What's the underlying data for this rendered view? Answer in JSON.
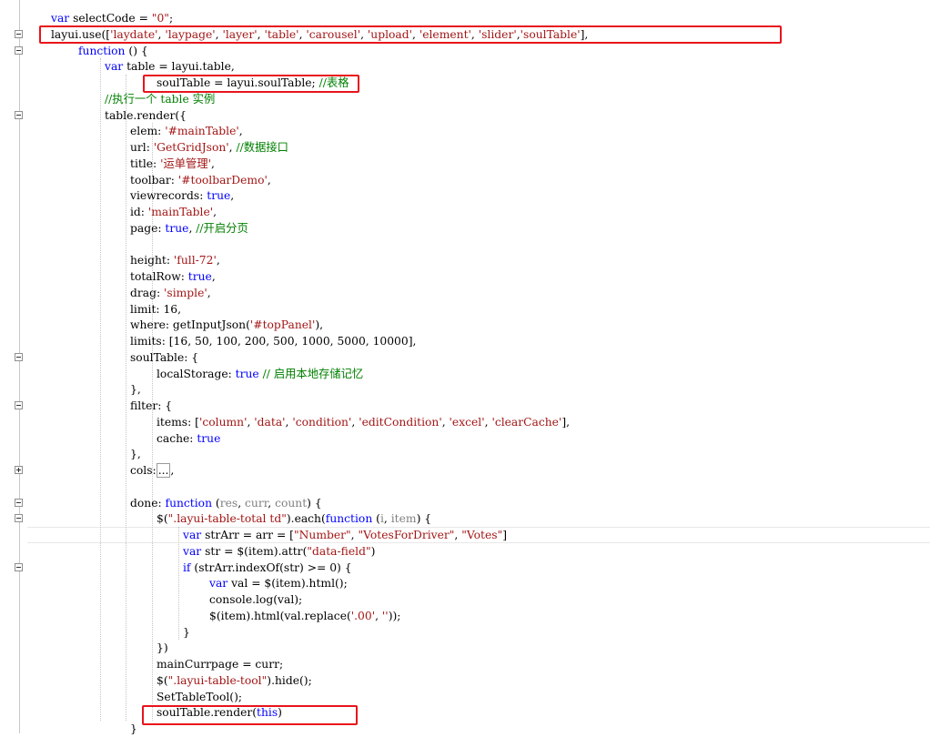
{
  "editor": {
    "lines": [
      {
        "id": 0,
        "tokens": [
          {
            "t": "var",
            "c": "kw"
          },
          {
            "t": " selectCode = "
          },
          {
            "t": "\"0\"",
            "c": "str"
          },
          {
            "t": ";"
          }
        ]
      },
      {
        "id": 1,
        "tokens": [
          {
            "t": "layui.use(["
          },
          {
            "t": "'laydate'",
            "c": "str"
          },
          {
            "t": ", "
          },
          {
            "t": "'laypage'",
            "c": "str"
          },
          {
            "t": ", "
          },
          {
            "t": "'layer'",
            "c": "str"
          },
          {
            "t": ", "
          },
          {
            "t": "'table'",
            "c": "str"
          },
          {
            "t": ", "
          },
          {
            "t": "'carousel'",
            "c": "str"
          },
          {
            "t": ", "
          },
          {
            "t": "'upload'",
            "c": "str"
          },
          {
            "t": ", "
          },
          {
            "t": "'element'",
            "c": "str"
          },
          {
            "t": ", "
          },
          {
            "t": "'slider'",
            "c": "str"
          },
          {
            "t": ","
          },
          {
            "t": "'soulTable'",
            "c": "str"
          },
          {
            "t": "],"
          }
        ]
      },
      {
        "id": 2,
        "tokens": [
          {
            "t": "function",
            "c": "kw"
          },
          {
            "t": " () {"
          }
        ]
      },
      {
        "id": 3,
        "tokens": [
          {
            "t": "var",
            "c": "kw"
          },
          {
            "t": " table = layui.table,"
          }
        ]
      },
      {
        "id": 4,
        "tokens": [
          {
            "t": "soulTable = layui.soulTable; "
          },
          {
            "t": "//表格",
            "c": "cmt"
          }
        ]
      },
      {
        "id": 5,
        "tokens": [
          {
            "t": "//执行一个 table 实例",
            "c": "cmt"
          }
        ]
      },
      {
        "id": 6,
        "tokens": [
          {
            "t": "table.render({"
          }
        ]
      },
      {
        "id": 7,
        "tokens": [
          {
            "t": "elem: "
          },
          {
            "t": "'#mainTable'",
            "c": "str"
          },
          {
            "t": ","
          }
        ]
      },
      {
        "id": 8,
        "tokens": [
          {
            "t": "url: "
          },
          {
            "t": "'GetGridJson'",
            "c": "str"
          },
          {
            "t": ", "
          },
          {
            "t": "//数据接口",
            "c": "cmt"
          }
        ]
      },
      {
        "id": 9,
        "tokens": [
          {
            "t": "title: "
          },
          {
            "t": "'运单管理'",
            "c": "str"
          },
          {
            "t": ","
          }
        ]
      },
      {
        "id": 10,
        "tokens": [
          {
            "t": "toolbar: "
          },
          {
            "t": "'#toolbarDemo'",
            "c": "str"
          },
          {
            "t": ","
          }
        ]
      },
      {
        "id": 11,
        "tokens": [
          {
            "t": "viewrecords: "
          },
          {
            "t": "true",
            "c": "kw"
          },
          {
            "t": ","
          }
        ]
      },
      {
        "id": 12,
        "tokens": [
          {
            "t": "id: "
          },
          {
            "t": "'mainTable'",
            "c": "str"
          },
          {
            "t": ","
          }
        ]
      },
      {
        "id": 13,
        "tokens": [
          {
            "t": "page: "
          },
          {
            "t": "true",
            "c": "kw"
          },
          {
            "t": ", "
          },
          {
            "t": "//开启分页",
            "c": "cmt"
          }
        ]
      },
      {
        "id": 14,
        "tokens": []
      },
      {
        "id": 15,
        "tokens": [
          {
            "t": "height: "
          },
          {
            "t": "'full-72'",
            "c": "str"
          },
          {
            "t": ","
          }
        ]
      },
      {
        "id": 16,
        "tokens": [
          {
            "t": "totalRow: "
          },
          {
            "t": "true",
            "c": "kw"
          },
          {
            "t": ","
          }
        ]
      },
      {
        "id": 17,
        "tokens": [
          {
            "t": "drag: "
          },
          {
            "t": "'simple'",
            "c": "str"
          },
          {
            "t": ","
          }
        ]
      },
      {
        "id": 18,
        "tokens": [
          {
            "t": "limit: 16,"
          }
        ]
      },
      {
        "id": 19,
        "tokens": [
          {
            "t": "where: getInputJson("
          },
          {
            "t": "'#topPanel'",
            "c": "str"
          },
          {
            "t": "),"
          }
        ]
      },
      {
        "id": 20,
        "tokens": [
          {
            "t": "limits: [16, 50, 100, 200, 500, 1000, 5000, 10000],"
          }
        ]
      },
      {
        "id": 21,
        "tokens": [
          {
            "t": "soulTable: {"
          }
        ]
      },
      {
        "id": 22,
        "tokens": [
          {
            "t": "localStorage: "
          },
          {
            "t": "true",
            "c": "kw"
          },
          {
            "t": " "
          },
          {
            "t": "// 启用本地存储记忆",
            "c": "cmt"
          }
        ]
      },
      {
        "id": 23,
        "tokens": [
          {
            "t": "},"
          }
        ]
      },
      {
        "id": 24,
        "tokens": [
          {
            "t": "filter: {"
          }
        ]
      },
      {
        "id": 25,
        "tokens": [
          {
            "t": "items: ["
          },
          {
            "t": "'column'",
            "c": "str"
          },
          {
            "t": ", "
          },
          {
            "t": "'data'",
            "c": "str"
          },
          {
            "t": ", "
          },
          {
            "t": "'condition'",
            "c": "str"
          },
          {
            "t": ", "
          },
          {
            "t": "'editCondition'",
            "c": "str"
          },
          {
            "t": ", "
          },
          {
            "t": "'excel'",
            "c": "str"
          },
          {
            "t": ", "
          },
          {
            "t": "'clearCache'",
            "c": "str"
          },
          {
            "t": "],"
          }
        ]
      },
      {
        "id": 26,
        "tokens": [
          {
            "t": "cache: "
          },
          {
            "t": "true",
            "c": "kw"
          }
        ]
      },
      {
        "id": 27,
        "tokens": [
          {
            "t": "},"
          }
        ]
      },
      {
        "id": 28,
        "tokens": [
          {
            "t": "cols:"
          },
          {
            "t": "...",
            "c": "collapsed"
          },
          {
            "t": ","
          }
        ]
      },
      {
        "id": 29,
        "tokens": []
      },
      {
        "id": 30,
        "tokens": [
          {
            "t": "done: "
          },
          {
            "t": "function",
            "c": "kw"
          },
          {
            "t": " ("
          },
          {
            "t": "res",
            "c": "prm"
          },
          {
            "t": ", "
          },
          {
            "t": "curr",
            "c": "prm"
          },
          {
            "t": ", "
          },
          {
            "t": "count",
            "c": "prm"
          },
          {
            "t": ") {"
          }
        ]
      },
      {
        "id": 31,
        "tokens": [
          {
            "t": "$("
          },
          {
            "t": "\".layui-table-total td\"",
            "c": "str"
          },
          {
            "t": ").each("
          },
          {
            "t": "function",
            "c": "kw"
          },
          {
            "t": " ("
          },
          {
            "t": "i",
            "c": "prm"
          },
          {
            "t": ", "
          },
          {
            "t": "item",
            "c": "prm"
          },
          {
            "t": ") {"
          }
        ]
      },
      {
        "id": 32,
        "tokens": [
          {
            "t": "var",
            "c": "kw"
          },
          {
            "t": " strArr = arr = ["
          },
          {
            "t": "\"Number\"",
            "c": "str"
          },
          {
            "t": ", "
          },
          {
            "t": "\"VotesForDriver\"",
            "c": "str"
          },
          {
            "t": ", "
          },
          {
            "t": "\"Votes\"",
            "c": "str"
          },
          {
            "t": "]"
          }
        ]
      },
      {
        "id": 33,
        "tokens": [
          {
            "t": "var",
            "c": "kw"
          },
          {
            "t": " str = $(item).attr("
          },
          {
            "t": "\"data-field\"",
            "c": "str"
          },
          {
            "t": ")"
          }
        ]
      },
      {
        "id": 34,
        "tokens": [
          {
            "t": "if",
            "c": "kw"
          },
          {
            "t": " (strArr.indexOf(str) >= 0) {"
          }
        ]
      },
      {
        "id": 35,
        "tokens": [
          {
            "t": "var",
            "c": "kw"
          },
          {
            "t": " val = $(item).html();"
          }
        ]
      },
      {
        "id": 36,
        "tokens": [
          {
            "t": "console.log(val);"
          }
        ]
      },
      {
        "id": 37,
        "tokens": [
          {
            "t": "$(item).html(val.replace("
          },
          {
            "t": "'.00'",
            "c": "str"
          },
          {
            "t": ", "
          },
          {
            "t": "''",
            "c": "str"
          },
          {
            "t": "));"
          }
        ]
      },
      {
        "id": 38,
        "tokens": [
          {
            "t": "}"
          }
        ]
      },
      {
        "id": 39,
        "tokens": [
          {
            "t": "})"
          }
        ]
      },
      {
        "id": 40,
        "tokens": [
          {
            "t": "mainCurrpage = curr;"
          }
        ]
      },
      {
        "id": 41,
        "tokens": [
          {
            "t": "$("
          },
          {
            "t": "\".layui-table-tool\"",
            "c": "str"
          },
          {
            "t": ").hide();"
          }
        ]
      },
      {
        "id": 42,
        "tokens": [
          {
            "t": "SetTableTool();"
          }
        ]
      },
      {
        "id": 43,
        "tokens": [
          {
            "t": "soulTable.render("
          },
          {
            "t": "this",
            "c": "kw"
          },
          {
            "t": ")"
          }
        ]
      },
      {
        "id": 44,
        "tokens": [
          {
            "t": "}"
          }
        ]
      }
    ]
  },
  "colors": {
    "keyword": "#0000ff",
    "string": "#a31515",
    "comment": "#008000",
    "param": "#808080",
    "highlight_box": "#e8141b"
  }
}
